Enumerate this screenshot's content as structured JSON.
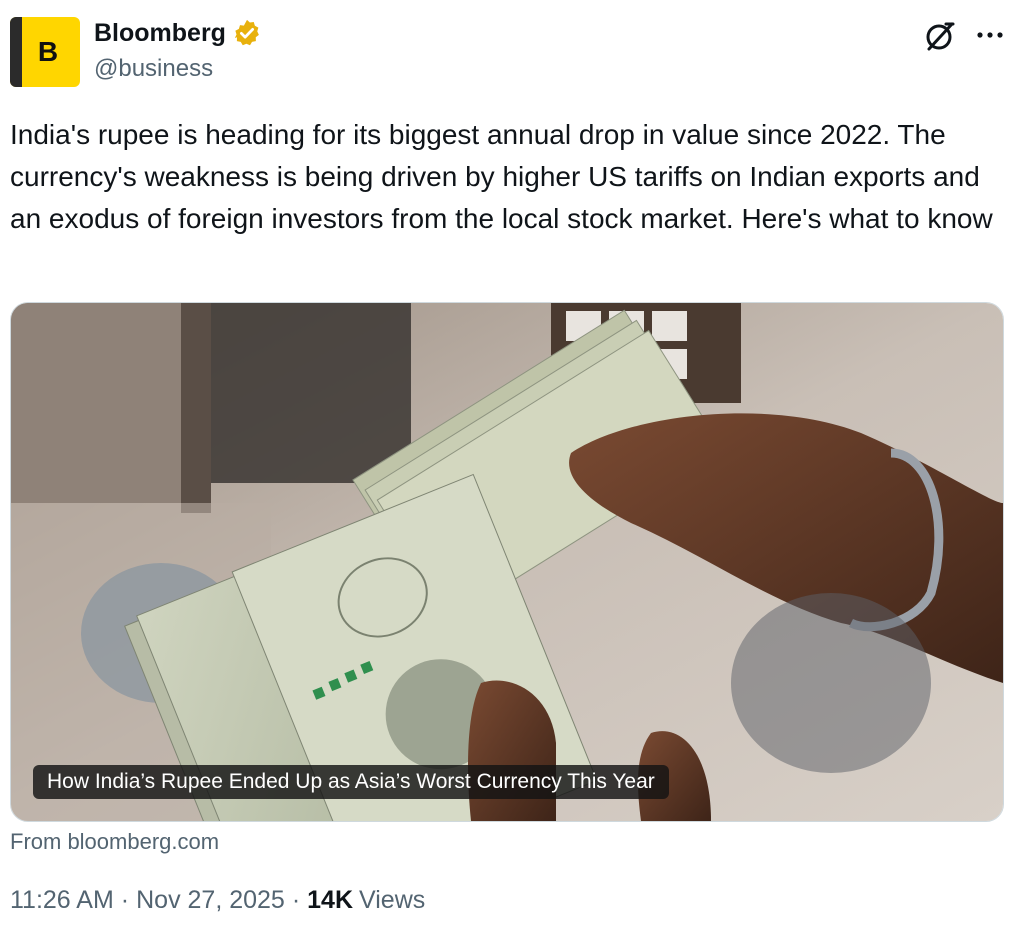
{
  "author": {
    "avatar_letter": "B",
    "display_name": "Bloomberg",
    "handle": "@business",
    "verified_badge": "gold-verified-icon"
  },
  "tweet": {
    "text": "India's rupee is heading for its biggest annual drop in value since 2022. The currency's weakness is being driven by higher US tariffs on Indian exports and an exodus of foreign investors from the local stock market. Here's what to know"
  },
  "card": {
    "caption": "How India’s Rupee Ended Up as Asia’s Worst Currency This Year",
    "image_description_icon": "photo-of-rupee-notes-in-hands"
  },
  "source": "From bloomberg.com",
  "meta": {
    "time": "11:26 AM",
    "separator": "·",
    "date": "Nov 27, 2025",
    "views_count": "14K",
    "views_label": "Views"
  },
  "colors": {
    "avatar_bg": "#ffd600",
    "verified_gold": "#e8b10d",
    "secondary_text": "#536471"
  }
}
